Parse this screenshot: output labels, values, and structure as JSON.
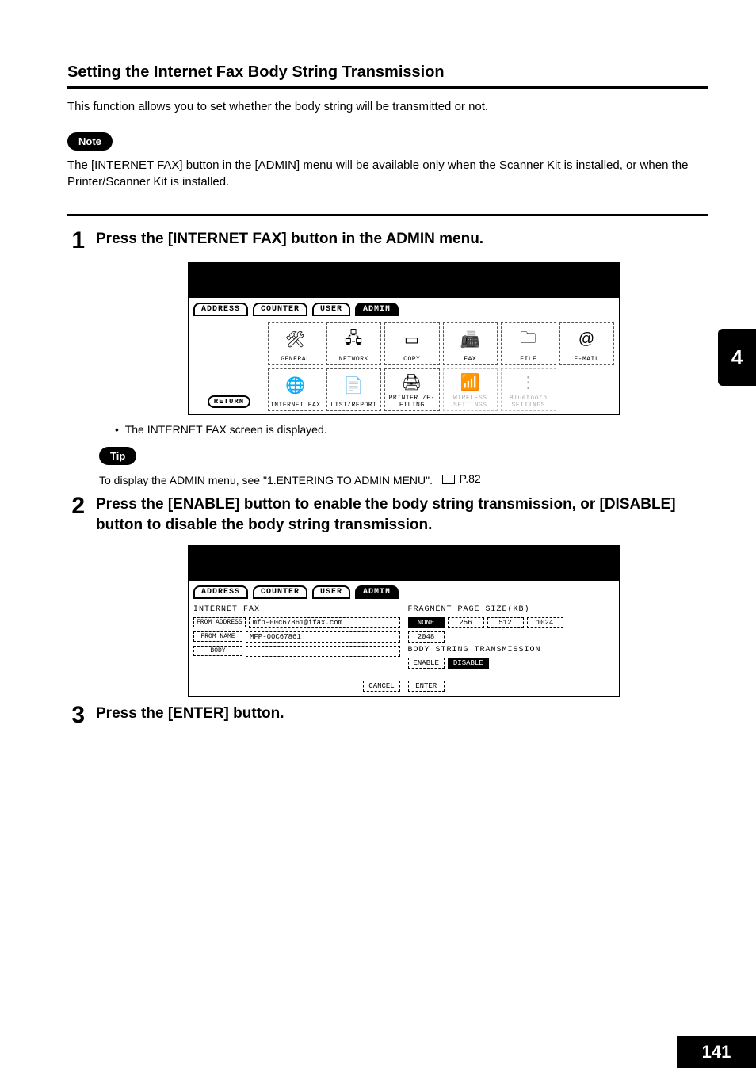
{
  "section_title": "Setting the Internet Fax Body String Transmission",
  "intro": "This function allows you to set whether the body string will be transmitted or not.",
  "note_label": "Note",
  "note_body": "The [INTERNET FAX] button in the [ADMIN] menu will be available only when the Scanner Kit is installed, or when the Printer/Scanner Kit is installed.",
  "steps": {
    "s1": {
      "num": "1",
      "title": "Press the [INTERNET FAX] button in the ADMIN menu."
    },
    "s2": {
      "num": "2",
      "title": "Press the [ENABLE] button to enable the body string transmission, or [DISABLE] button to disable the body string transmission."
    },
    "s3": {
      "num": "3",
      "title": "Press the [ENTER] button."
    }
  },
  "bullet1": "The INTERNET FAX screen is displayed.",
  "tip_label": "Tip",
  "tip_body_prefix": "To display the ADMIN menu, see \"1.ENTERING TO ADMIN MENU\".",
  "tip_ref": "P.82",
  "screen1": {
    "tabs": {
      "address": "ADDRESS",
      "counter": "COUNTER",
      "user": "USER",
      "admin": "ADMIN"
    },
    "return": "RETURN",
    "row1": [
      "GENERAL",
      "NETWORK",
      "COPY",
      "FAX",
      "FILE",
      "E-MAIL"
    ],
    "row2": [
      "INTERNET FAX",
      "LIST/REPORT",
      "PRINTER\n/E-FILING",
      "WIRELESS\nSETTINGS",
      "Bluetooth\nSETTINGS"
    ]
  },
  "screen2": {
    "tabs": {
      "address": "ADDRESS",
      "counter": "COUNTER",
      "user": "USER",
      "admin": "ADMIN"
    },
    "left_title": "INTERNET FAX",
    "from_address_label": "FROM ADDRESS",
    "from_address_value": "mfp-00c67861@ifax.com",
    "from_name_label": "FROM NAME",
    "from_name_value": "MFP-00C67861",
    "body_label": "BODY",
    "right_title": "FRAGMENT PAGE SIZE(KB)",
    "frag_opts": [
      "NONE",
      "256",
      "512",
      "1024",
      "2048"
    ],
    "bst_title": "BODY STRING TRANSMISSION",
    "bst_opts": {
      "enable": "ENABLE",
      "disable": "DISABLE"
    },
    "cancel": "CANCEL",
    "enter": "ENTER"
  },
  "thumb": "4",
  "page_num": "141"
}
